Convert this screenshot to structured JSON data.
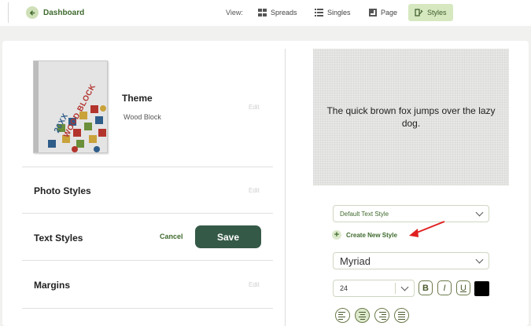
{
  "topbar": {
    "back_label": "Dashboard",
    "view_label": "View:",
    "views": [
      {
        "label": "Spreads",
        "icon": "grid-icon"
      },
      {
        "label": "Singles",
        "icon": "list-icon"
      },
      {
        "label": "Page",
        "icon": "page-icon"
      },
      {
        "label": "Styles",
        "icon": "styles-icon",
        "active": true
      }
    ]
  },
  "theme": {
    "title": "Theme",
    "name": "Wood Block",
    "edit": "Edit",
    "cover_year": "20XX",
    "cover_title": "WOOD BLOCK"
  },
  "photo_styles": {
    "title": "Photo Styles",
    "edit": "Edit"
  },
  "text_styles": {
    "title": "Text Styles",
    "cancel": "Cancel",
    "save": "Save"
  },
  "margins": {
    "title": "Margins",
    "edit": "Edit"
  },
  "preview": {
    "text": "The quick brown fox jumps over the lazy dog."
  },
  "style_select": {
    "value": "Default Text Style"
  },
  "create_style": {
    "label": "Create New Style"
  },
  "font_select": {
    "value": "Myriad"
  },
  "size_select": {
    "value": "24"
  },
  "format_buttons": [
    {
      "label": "B",
      "name": "bold"
    },
    {
      "label": "I",
      "name": "italic"
    },
    {
      "label": "U",
      "name": "underline"
    }
  ],
  "text_color": "#000000",
  "alignment": {
    "options": [
      "left",
      "center",
      "right",
      "justify"
    ],
    "selected": "center"
  },
  "colors": {
    "accent": "#3f6a2e",
    "active_bg": "#d6e8bf",
    "save_bg": "#355947",
    "annotation": "#e02020"
  }
}
